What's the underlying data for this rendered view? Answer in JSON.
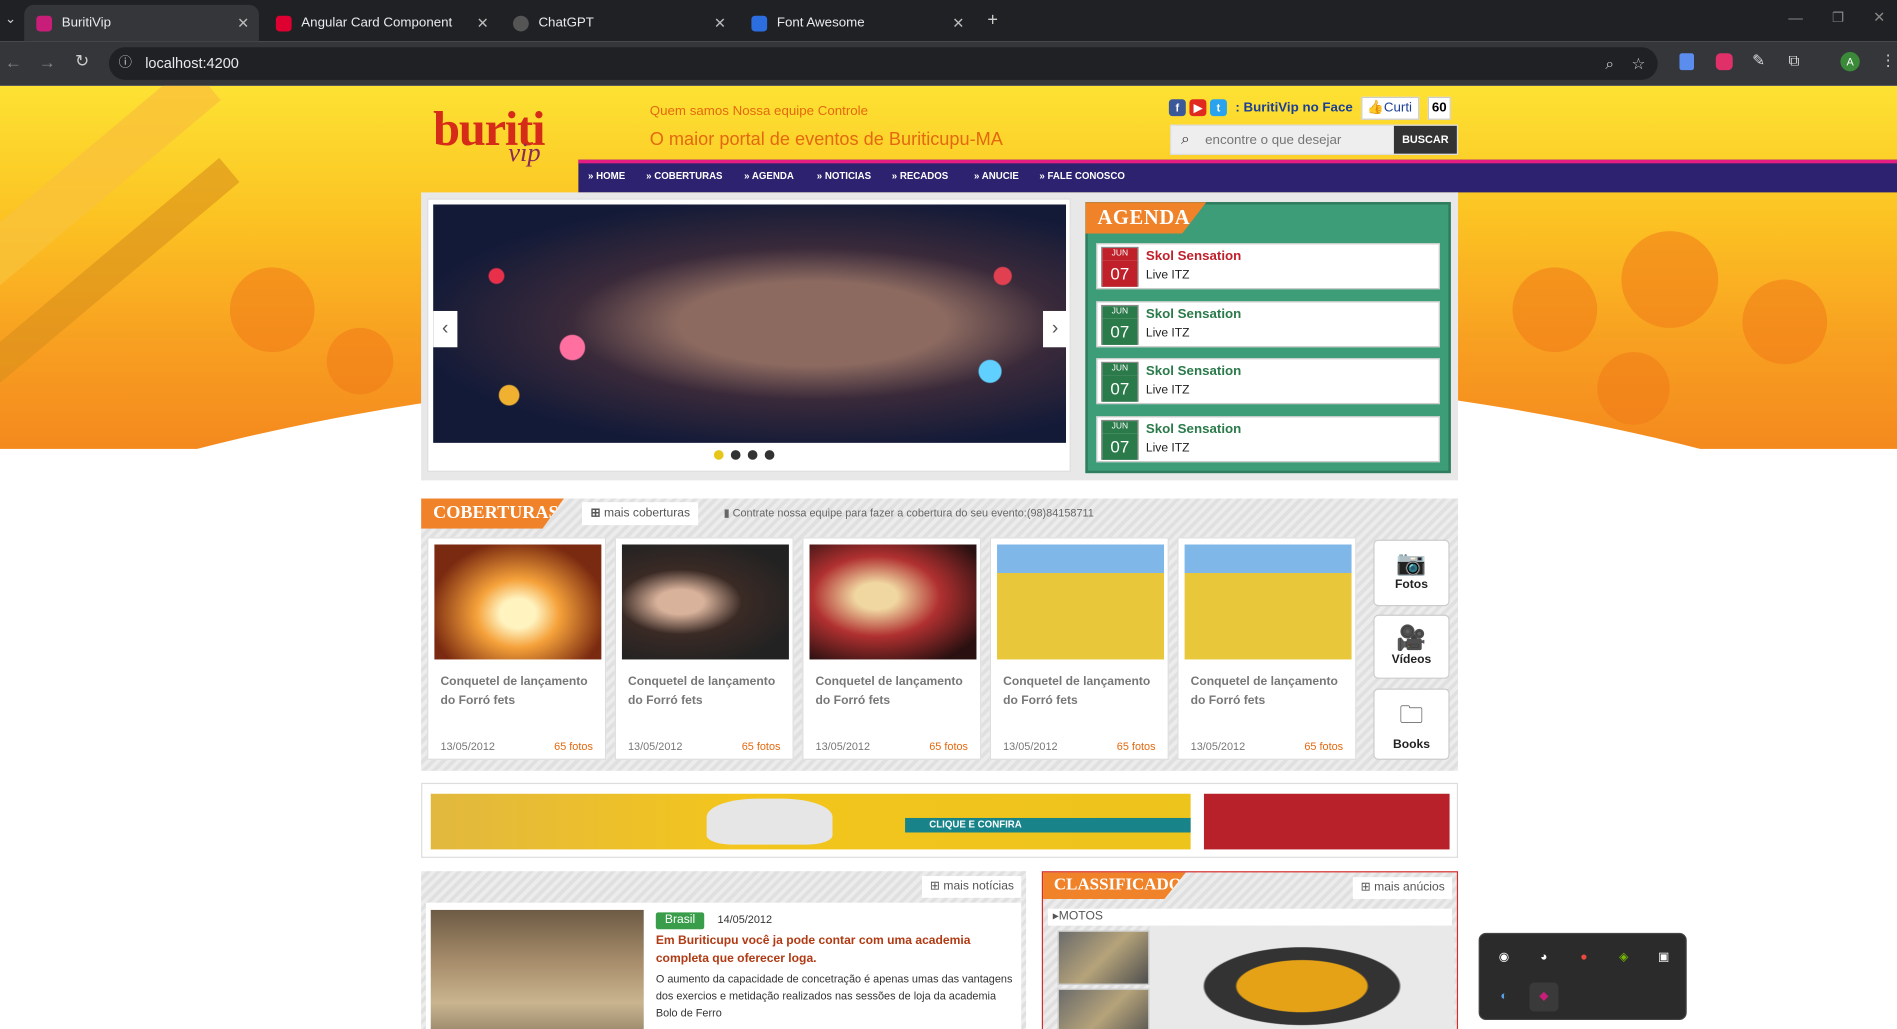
{
  "browser": {
    "tabs": [
      {
        "label": "BuritiVip",
        "active": true
      },
      {
        "label": "Angular Card Component",
        "active": false
      },
      {
        "label": "ChatGPT",
        "active": false
      },
      {
        "label": "Font Awesome",
        "active": false
      }
    ],
    "url": "localhost:4200",
    "profile_initial": "A"
  },
  "site": {
    "logo_text": "buriti",
    "logo_sub": "vip",
    "top_links": "Quem samos Nossa equipe Controle",
    "tagline": "O maior portal de eventos de Buriticupu-MA",
    "face_label": ": BuritiVip no Face",
    "curti_label": "Curti",
    "curti_count": "60",
    "search_placeholder": "encontre o que desejar",
    "search_button": "BUSCAR",
    "nav": [
      "HOME",
      "COBERTURAS",
      "AGENDA",
      "NOTICIAS",
      "RECADOS",
      "ANUCIE",
      "FALE CONOSCO"
    ]
  },
  "agenda": {
    "title": "AGENDA",
    "events": [
      {
        "month": "JUN",
        "day": "07",
        "title": "Skol Sensation",
        "place": "Live ITZ",
        "color": "#c0202a"
      },
      {
        "month": "JUN",
        "day": "07",
        "title": "Skol Sensation",
        "place": "Live ITZ",
        "color": "#2a7a4a"
      },
      {
        "month": "JUN",
        "day": "07",
        "title": "Skol Sensation",
        "place": "Live ITZ",
        "color": "#2a7a4a"
      },
      {
        "month": "JUN",
        "day": "07",
        "title": "Skol Sensation",
        "place": "Live ITZ",
        "color": "#2a7a4a"
      }
    ]
  },
  "coberturas": {
    "title": "COBERTURAS",
    "more": "mais coberturas",
    "contract": "Contrate nossa equipe para fazer a cobertura do seu evento:(98)84158711",
    "cards": [
      {
        "title": "Conquetel de lançamento do Forró fets",
        "date": "13/05/2012",
        "count": "65 fotos"
      },
      {
        "title": "Conquetel de lançamento do Forró fets",
        "date": "13/05/2012",
        "count": "65 fotos"
      },
      {
        "title": "Conquetel de lançamento do Forró fets",
        "date": "13/05/2012",
        "count": "65 fotos"
      },
      {
        "title": "Conquetel de lançamento do Forró fets",
        "date": "13/05/2012",
        "count": "65 fotos"
      },
      {
        "title": "Conquetel de lançamento do Forró fets",
        "date": "13/05/2012",
        "count": "65 fotos"
      }
    ],
    "media": [
      "Fotos",
      "Vídeos",
      "Books"
    ]
  },
  "banner": {
    "cta": "CLIQUE E CONFIRA"
  },
  "noticias": {
    "more": "mais notícias",
    "tag": "Brasil",
    "date": "14/05/2012",
    "title": "Em Buriticupu você ja pode contar com uma academia completa que oferecer loga.",
    "body": "O aumento da capacidade de concetração é apenas umas das vantagens dos exercios e metidação realizados nas sessões de loja da academia Bolo de Ferro"
  },
  "classificados": {
    "title": "CLASSIFICADOS",
    "more": "mais anúcios",
    "category": "MOTOS"
  }
}
